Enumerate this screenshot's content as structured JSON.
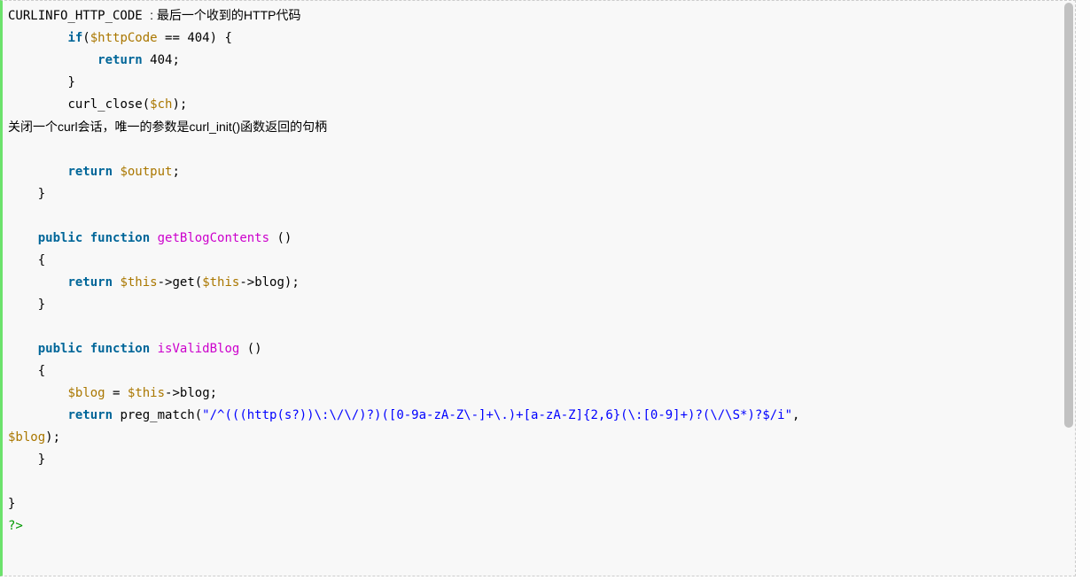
{
  "code": {
    "l1_const": "CURLINFO_HTTP_CODE ",
    "l1_cn": ": 最后一个收到的HTTP代码",
    "l2_indent": "        ",
    "l2_if": "if",
    "l2_paren_open": "(",
    "l2_var": "$httpCode",
    "l2_eq": " == ",
    "l2_num": "404",
    "l2_close": ") {",
    "l3_indent": "            ",
    "l3_ret": "return",
    "l3_sp": " ",
    "l3_num": "404",
    "l3_semi": ";",
    "l4_indent": "        ",
    "l4_brace": "}",
    "l5_indent": "        ",
    "l5_fn": "curl_close(",
    "l5_var": "$ch",
    "l5_close": ");",
    "l6_cn": "关闭一个curl会话，唯一的参数是curl_init()函数返回的句柄",
    "l7_blank": " ",
    "l8_indent": "        ",
    "l8_ret": "return",
    "l8_sp": " ",
    "l8_var": "$output",
    "l8_semi": ";",
    "l9_indent": "    ",
    "l9_brace": "}",
    "l10_blank": " ",
    "l11_indent": "    ",
    "l11_pub": "public",
    "l11_sp1": " ",
    "l11_func": "function",
    "l11_sp2": " ",
    "l11_name": "getBlogContents",
    "l11_rest": " ()",
    "l12_indent": "    ",
    "l12_brace": "{",
    "l13_indent": "        ",
    "l13_ret": "return",
    "l13_sp": " ",
    "l13_this1": "$this",
    "l13_arrow1": "->get(",
    "l13_this2": "$this",
    "l13_arrow2": "->blog);",
    "l14_indent": "    ",
    "l14_brace": "}",
    "l15_blank": " ",
    "l16_indent": "    ",
    "l16_pub": "public",
    "l16_sp1": " ",
    "l16_func": "function",
    "l16_sp2": " ",
    "l16_name": "isValidBlog",
    "l16_rest": " ()",
    "l17_indent": "    ",
    "l17_brace": "{",
    "l18_indent": "        ",
    "l18_var": "$blog",
    "l18_eq": " = ",
    "l18_this": "$this",
    "l18_rest": "->blog;",
    "l19_indent": "        ",
    "l19_ret": "return",
    "l19_sp": " ",
    "l19_fn": "preg_match(",
    "l19_str": "\"/^(((http(s?))\\:\\/\\/)?)([0-9a-zA-Z\\-]+\\.)+[a-zA-Z]{2,6}(\\:[0-9]+)?(\\/\\S*)?$/i\"",
    "l19_comma": ", ",
    "l20_var": "$blog",
    "l20_close": ");",
    "l21_indent": "    ",
    "l21_brace": "}",
    "l22_blank": " ",
    "l23_brace": "}",
    "l24_tag": "?>"
  }
}
